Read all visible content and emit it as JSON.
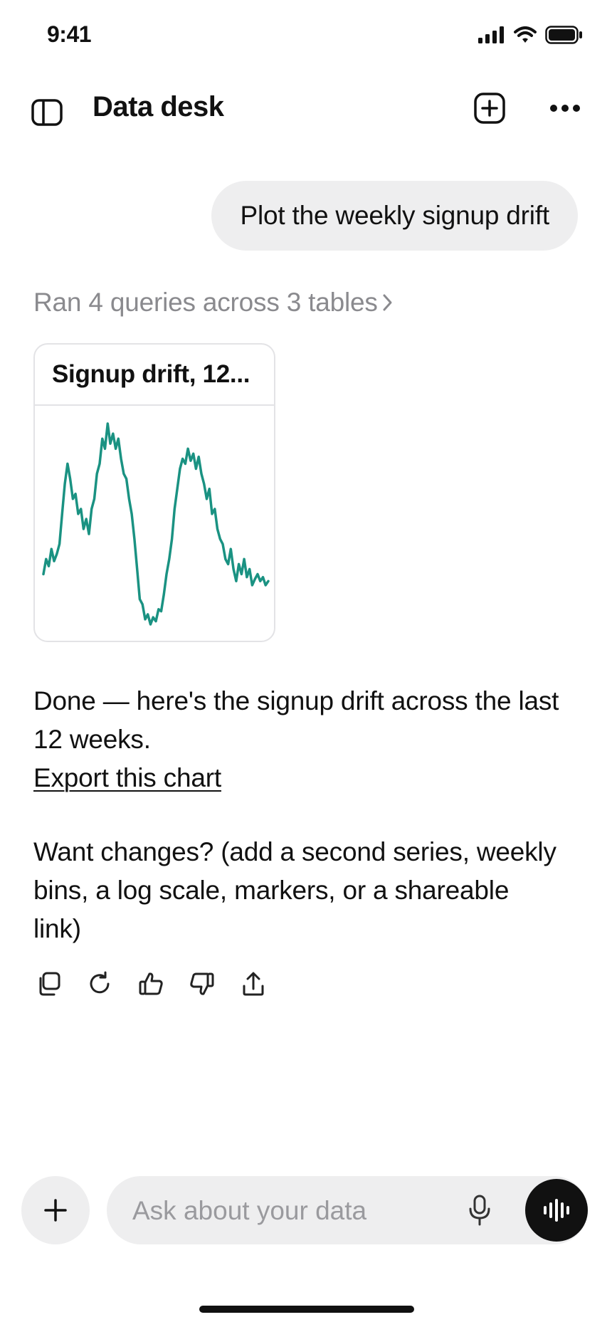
{
  "status_bar": {
    "time": "9:41",
    "icons": [
      "signal-icon",
      "wifi-icon",
      "battery-icon"
    ]
  },
  "header": {
    "title": "Data desk",
    "icons": [
      "sidebar-toggle-icon",
      "new-chat-icon",
      "more-icon"
    ]
  },
  "conversation": {
    "user_message": "Plot the weekly signup drift",
    "queries_summary": "Ran 4 queries across 3 tables",
    "chart_card": {
      "title": "Signup drift, 12..."
    },
    "assistant_text": "Done — here's the signup drift across the last 12 weeks.",
    "export_link": "Export this chart",
    "followup": "Want changes? (add a second series, weekly bins, a log scale, markers, or a shareable link)",
    "action_icons": [
      "copy-icon",
      "regenerate-icon",
      "thumbs-up-icon",
      "thumbs-down-icon",
      "share-icon"
    ]
  },
  "composer": {
    "placeholder": "Ask about your data",
    "icons": [
      "plus-icon",
      "microphone-icon",
      "voice-waveform-icon"
    ]
  },
  "colors": {
    "series": "#1a9282",
    "bubble": "#eeeeef",
    "muted_text": "#8a8a8e",
    "border": "#e3e3e6"
  },
  "chart_data": {
    "type": "line",
    "x": [
      0,
      1,
      2,
      3,
      4,
      5,
      6,
      7,
      8,
      9,
      10,
      11,
      12,
      13,
      14,
      15,
      16,
      17,
      18,
      19,
      20,
      21,
      22,
      23,
      24,
      25,
      26,
      27,
      28,
      29,
      30,
      31,
      32,
      33,
      34,
      35,
      36,
      37,
      38,
      39,
      40,
      41,
      42,
      43,
      44,
      45,
      46,
      47,
      48,
      49,
      50,
      51,
      52,
      53,
      54,
      55,
      56,
      57,
      58,
      59,
      60,
      61,
      62,
      63,
      64,
      65,
      66,
      67,
      68,
      69,
      70,
      71,
      72,
      73,
      74,
      75,
      76,
      77,
      78,
      79,
      80,
      81,
      82,
      83,
      84
    ],
    "series": [
      {
        "values": [
          -0.55,
          -0.4,
          -0.47,
          -0.3,
          -0.42,
          -0.35,
          -0.25,
          0.05,
          0.35,
          0.55,
          0.4,
          0.2,
          0.25,
          0.05,
          0.1,
          -0.1,
          0.0,
          -0.15,
          0.1,
          0.2,
          0.45,
          0.55,
          0.8,
          0.7,
          0.95,
          0.75,
          0.85,
          0.7,
          0.8,
          0.6,
          0.45,
          0.4,
          0.2,
          0.05,
          -0.2,
          -0.5,
          -0.8,
          -0.85,
          -1.0,
          -0.95,
          -1.05,
          -0.98,
          -1.02,
          -0.9,
          -0.92,
          -0.75,
          -0.55,
          -0.4,
          -0.2,
          0.1,
          0.3,
          0.5,
          0.6,
          0.55,
          0.7,
          0.58,
          0.65,
          0.5,
          0.62,
          0.45,
          0.35,
          0.2,
          0.3,
          0.05,
          0.1,
          -0.1,
          -0.2,
          -0.25,
          -0.4,
          -0.45,
          -0.3,
          -0.5,
          -0.62,
          -0.45,
          -0.55,
          -0.4,
          -0.58,
          -0.5,
          -0.66,
          -0.6,
          -0.55,
          -0.62,
          -0.58,
          -0.66,
          -0.62
        ]
      }
    ],
    "title": "Signup drift, 12...",
    "ylim": [
      -1.1,
      1.0
    ],
    "grid": false,
    "legend": false,
    "axes_visible": false
  }
}
